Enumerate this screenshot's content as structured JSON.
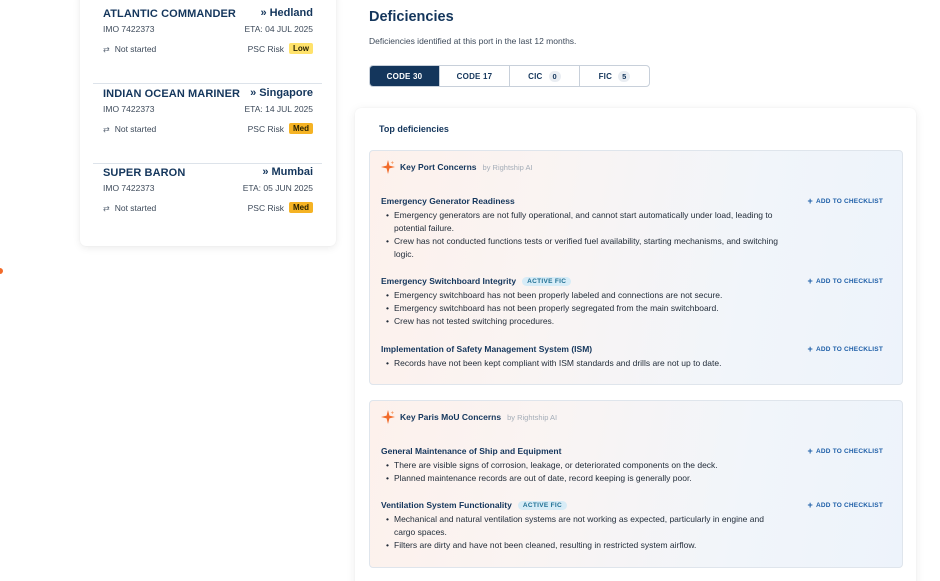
{
  "vessels": [
    {
      "name": "ATLANTIC COMMANDER",
      "imo": "IMO 7422373",
      "destination": "Hedland",
      "eta": "ETA: 04 JUL 2025",
      "status": "Not started",
      "risk_label": "PSC Risk",
      "risk": "Low"
    },
    {
      "name": "INDIAN OCEAN MARINER",
      "imo": "IMO 7422373",
      "destination": "Singapore",
      "eta": "ETA: 14 JUL 2025",
      "status": "Not started",
      "risk_label": "PSC Risk",
      "risk": "Med"
    },
    {
      "name": "SUPER BARON",
      "imo": "IMO 7422373",
      "destination": "Mumbai",
      "eta": "ETA: 05 JUN 2025",
      "status": "Not started",
      "risk_label": "PSC Risk",
      "risk": "Med"
    }
  ],
  "page": {
    "title": "Deficiencies",
    "subtitle": "Deficiencies identified at this port in the last 12 months."
  },
  "tabs": [
    {
      "label": "CODE 30",
      "count": null,
      "active": true
    },
    {
      "label": "CODE 17",
      "count": null,
      "active": false
    },
    {
      "label": "CIC",
      "count": "0",
      "active": false
    },
    {
      "label": "FIC",
      "count": "5",
      "active": false
    }
  ],
  "panel": {
    "title": "Top deficiencies",
    "add_label": "ADD TO CHECKLIST",
    "groups": [
      {
        "title": "Key Port Concerns",
        "by": "by Rightship AI",
        "items": [
          {
            "title": "Emergency Generator Readiness",
            "tag": null,
            "bullets": [
              "Emergency generators are not fully operational, and cannot start automatically under load, leading to potential failure.",
              "Crew has not conducted functions tests or verified fuel availability, starting mechanisms, and switching logic."
            ]
          },
          {
            "title": "Emergency Switchboard Integrity",
            "tag": "ACTIVE FIC",
            "bullets": [
              "Emergency switchboard has not been properly labeled and connections are not secure.",
              "Emergency switchboard has not been properly segregated from the main switchboard.",
              "Crew has not tested switching procedures."
            ]
          },
          {
            "title": "Implementation of Safety Management System (ISM)",
            "tag": null,
            "bullets": [
              "Records have not been kept compliant with ISM standards and drills are not up to date."
            ]
          }
        ]
      },
      {
        "title": "Key Paris MoU Concerns",
        "by": "by Rightship AI",
        "items": [
          {
            "title": "General Maintenance of Ship and Equipment",
            "tag": null,
            "bullets": [
              "There are visible signs of corrosion, leakage, or deteriorated components on the deck.",
              "Planned maintenance records are out of date, record keeping is generally poor."
            ]
          },
          {
            "title": "Ventilation System Functionality",
            "tag": "ACTIVE FIC",
            "bullets": [
              "Mechanical and natural ventilation systems are not working as expected, particularly in engine and cargo spaces.",
              "Filters are dirty and have not been cleaned, resulting in restricted system airflow."
            ]
          }
        ]
      }
    ]
  },
  "icons": {
    "status": "sliders-icon",
    "destination": "double-chevron-right-icon",
    "ai": "ai-sparkle-icon",
    "add": "plus-icon"
  },
  "colors": {
    "navy": "#14365c",
    "low": "#ffe26b",
    "med": "#f5b324",
    "accent_orange": "#f26b2a",
    "link": "#1e5fa8"
  }
}
